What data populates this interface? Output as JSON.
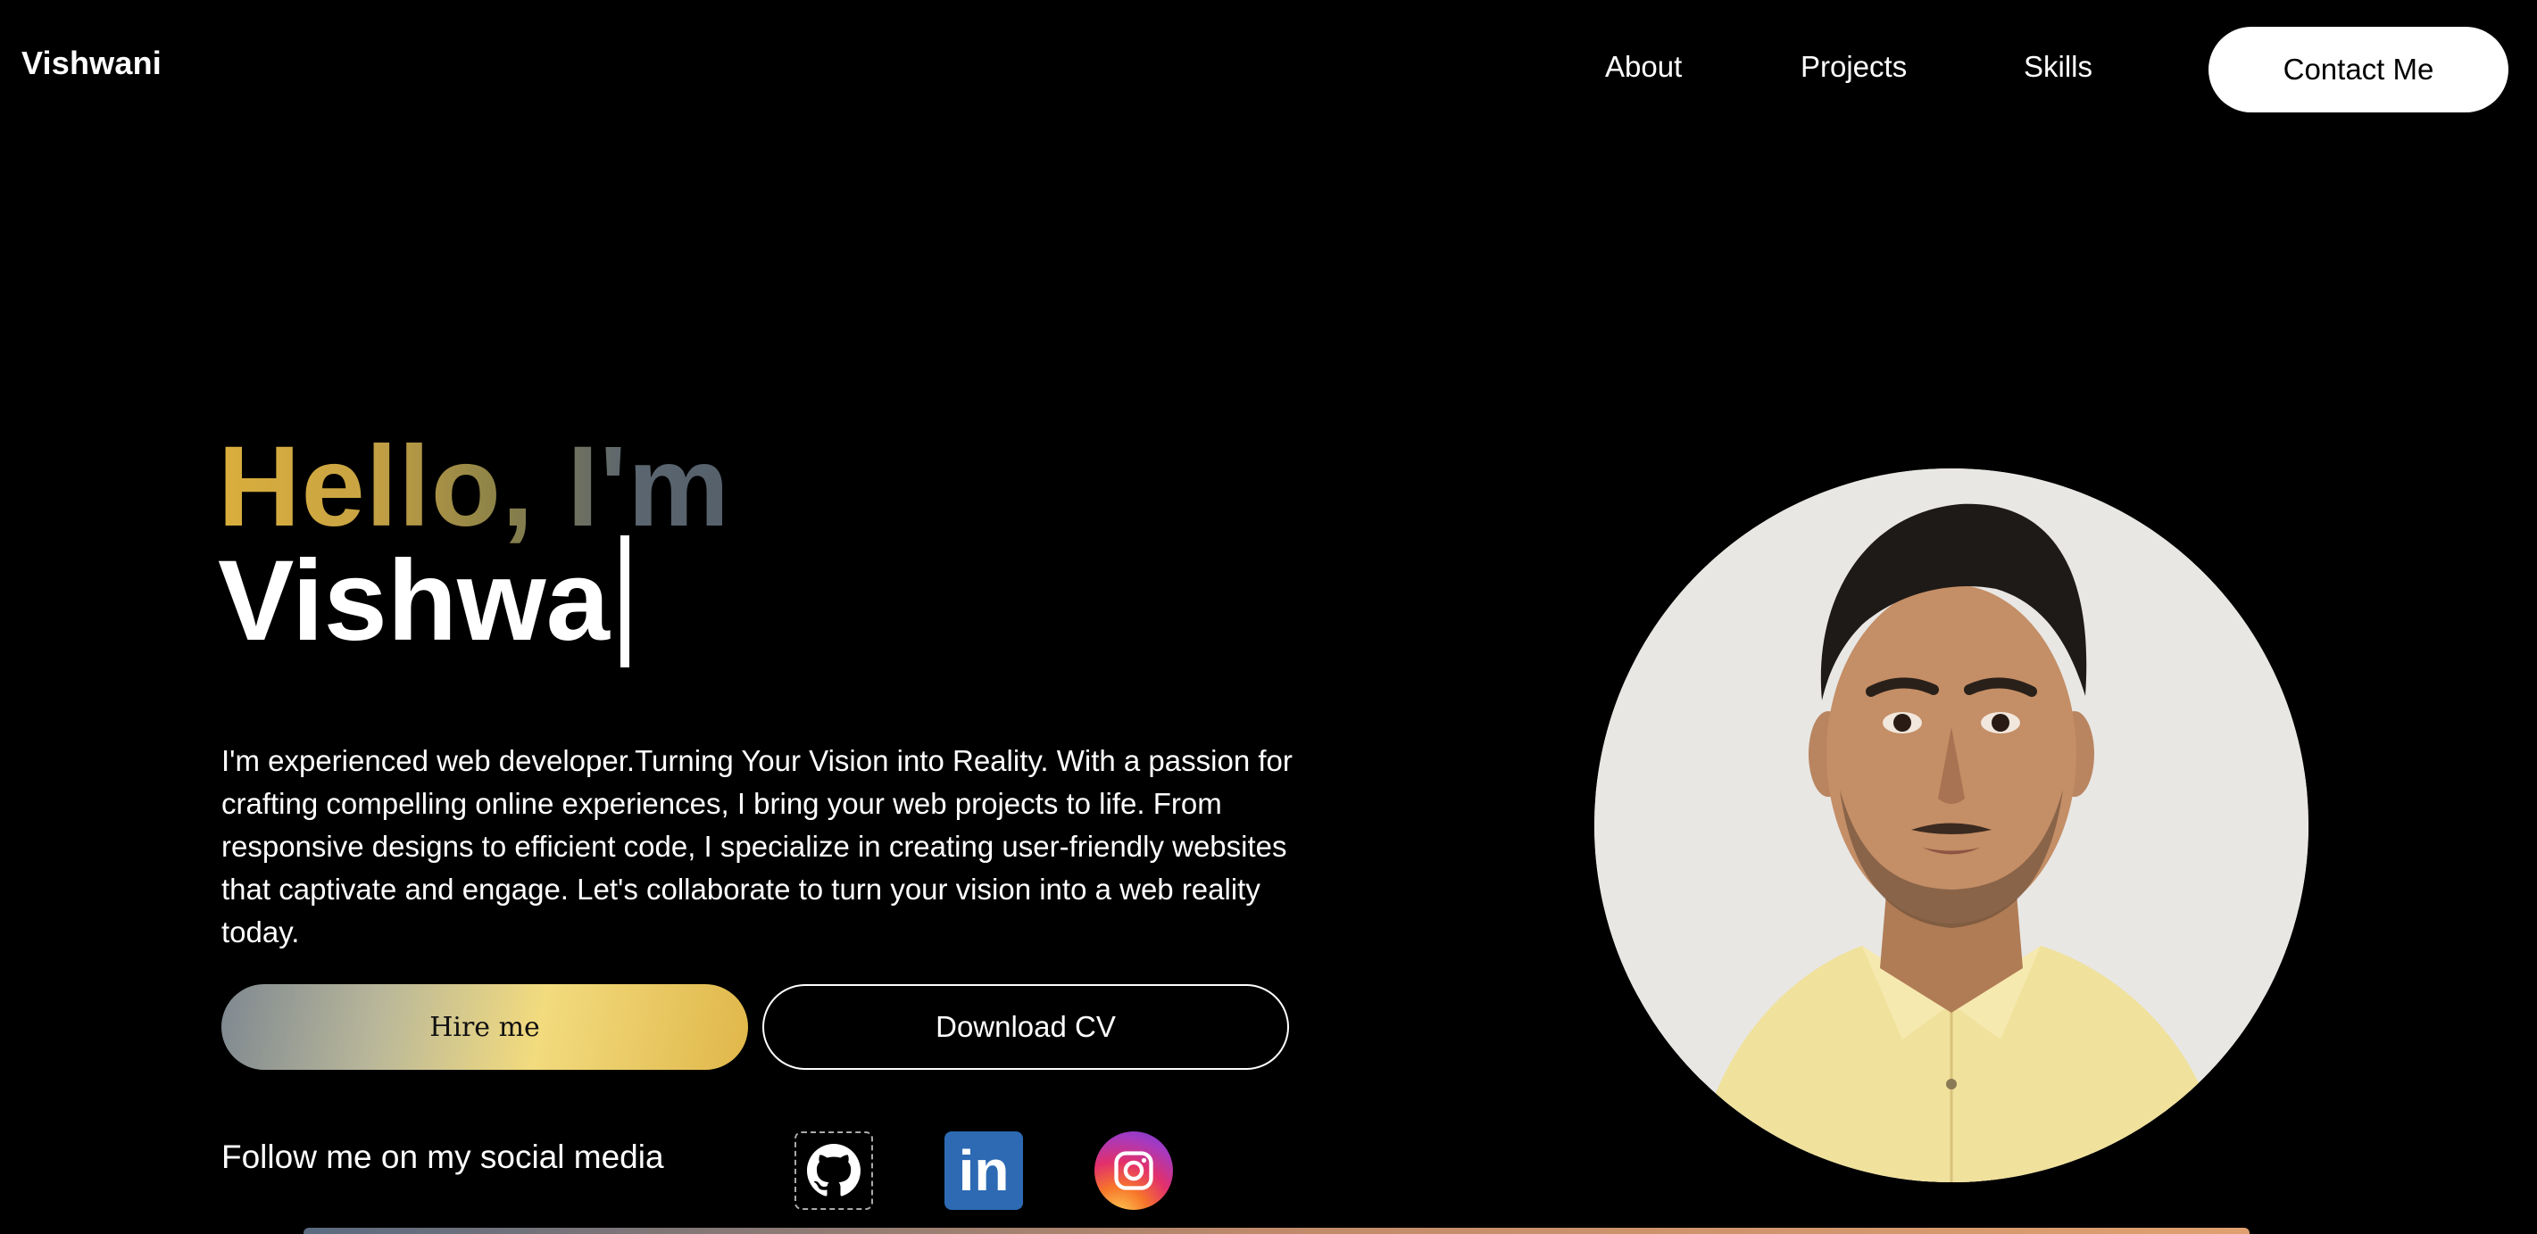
{
  "brand": {
    "logo": "Vishwani"
  },
  "nav": {
    "items": [
      "About",
      "Projects",
      "Skills"
    ],
    "contact_label": "Contact Me"
  },
  "hero": {
    "greeting": "Hello, I'm",
    "typed_name": "Vishwa",
    "intro": "I'm experienced web developer.Turning Your Vision into Reality. With a passion for crafting compelling online experiences, I bring your web projects to life. From responsive designs to efficient code, I specialize in creating user-friendly websites that captivate and engage. Let's collaborate to turn your vision into a web reality today.",
    "hire_label": "Hire me",
    "cv_label": "Download CV",
    "social_label": "Follow me on my social media"
  },
  "social": [
    {
      "name": "github-icon"
    },
    {
      "name": "linkedin-icon",
      "text": "in"
    },
    {
      "name": "instagram-icon"
    }
  ],
  "colors": {
    "background": "#000000",
    "accent_gold": "#d9ae3c",
    "linkedin": "#2d6ab3",
    "portrait_shirt": "#f1e3a0"
  }
}
